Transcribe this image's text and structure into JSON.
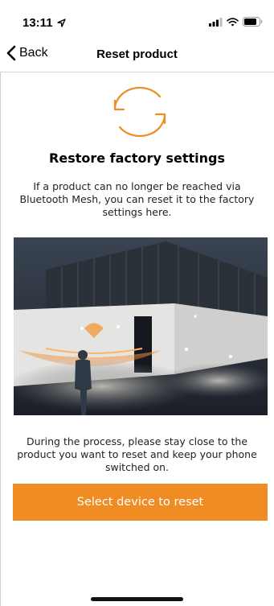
{
  "status_bar": {
    "time": "13:11",
    "icons": [
      "location-arrow-icon",
      "signal-icon",
      "wifi-icon",
      "battery-icon"
    ]
  },
  "nav": {
    "back_label": "Back",
    "title": "Reset product"
  },
  "content": {
    "icon": "reset-sync-icon",
    "headline": "Restore factory settings",
    "intro": "If a product can no longer be reached via Bluetooth Mesh, you can reset it to the factory settings here.",
    "image": "building-with-motion-sensor-lights",
    "process_text": "During the process, please stay close to the product you want to reset and keep your phone switched on."
  },
  "actions": {
    "select_device_label": "Select device to reset"
  },
  "colors": {
    "accent": "#f08c24",
    "divider": "#d8d8d8"
  }
}
